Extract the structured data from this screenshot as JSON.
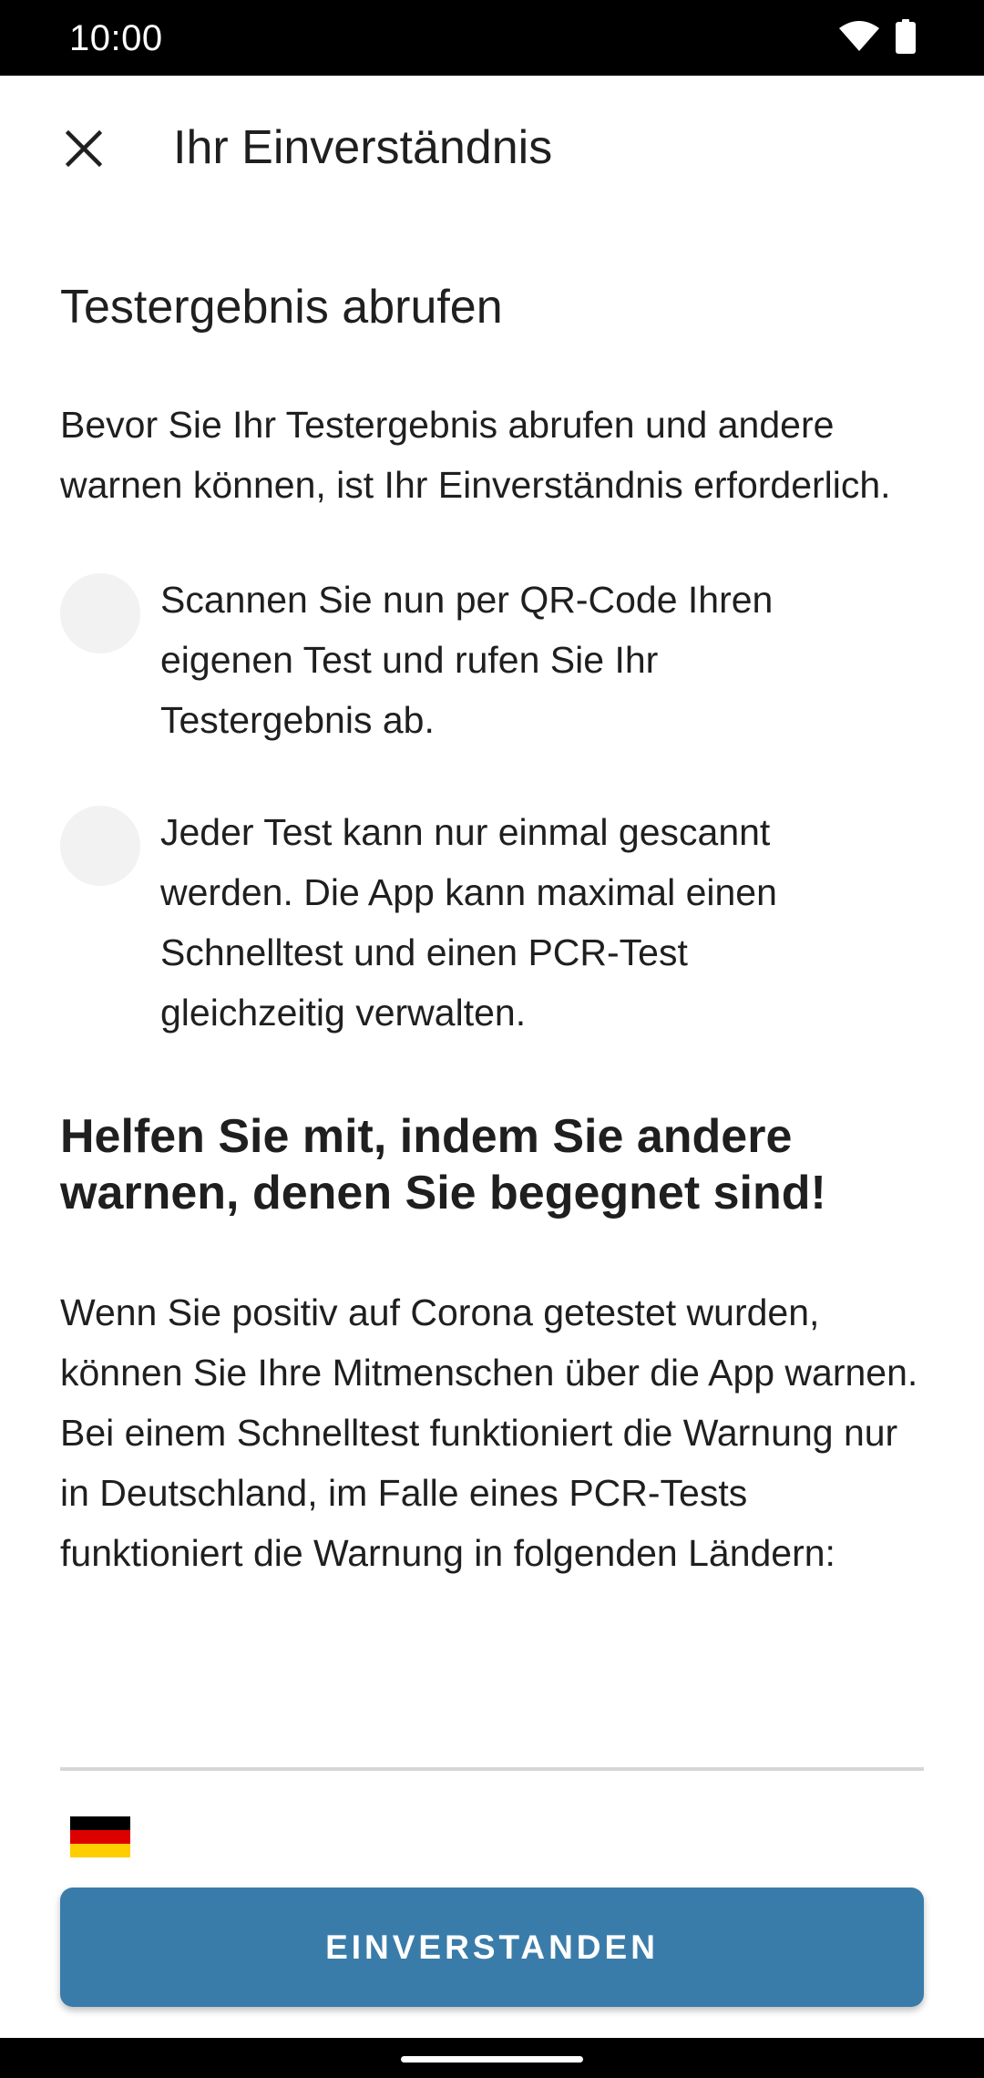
{
  "status_bar": {
    "time": "10:00",
    "icons": [
      "wifi-icon",
      "battery-icon"
    ]
  },
  "app_bar": {
    "title": "Ihr Einverständnis",
    "close_icon": "close-icon"
  },
  "section": {
    "title": "Testergebnis abrufen",
    "intro": "Bevor Sie Ihr Testergebnis abrufen und andere warnen können, ist Ihr Einverständnis erforderlich.",
    "bullets": [
      "Scannen Sie nun per QR-Code Ihren eigenen Test und rufen Sie Ihr Testergebnis ab.",
      "Jeder Test kann nur einmal gescannt werden. Die App kann maximal einen Schnelltest und einen PCR-Test gleichzeitig verwalten."
    ]
  },
  "help": {
    "heading": "Helfen Sie mit, indem Sie andere warnen, denen Sie begegnet sind!",
    "paragraph": "Wenn Sie positiv auf Corona getestet wurden, können Sie Ihre Mitmenschen über die App warnen. Bei einem Schnelltest funktioniert die Warnung nur in Deutschland, im Falle eines PCR-Tests funktioniert die Warnung in folgenden Ländern:"
  },
  "countries": [
    {
      "icon": "germany-flag-icon",
      "colors": [
        "#000000",
        "#dd0000",
        "#ffce00"
      ]
    }
  ],
  "cta": {
    "label": "EINVERSTANDEN",
    "color": "#3a7ca9"
  }
}
